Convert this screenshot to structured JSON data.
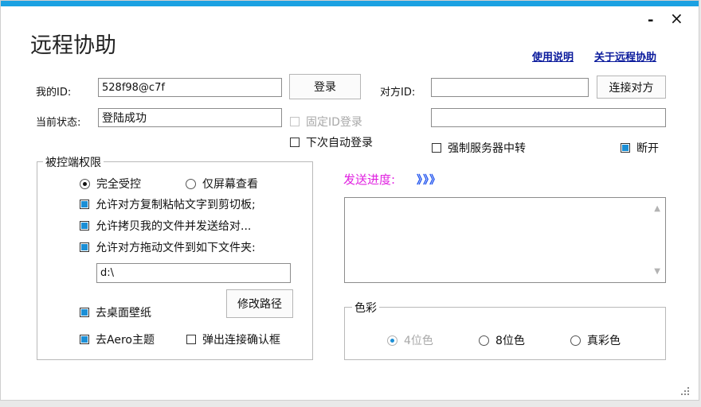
{
  "window": {
    "title": "远程协助",
    "minimize_label": "-",
    "close_label": "×"
  },
  "links": {
    "help": "使用说明",
    "about": "关于远程协助"
  },
  "my_id": {
    "label": "我的ID:",
    "value": "528f98@c7f"
  },
  "login_button": "登录",
  "peer_id": {
    "label": "对方ID:",
    "value": ""
  },
  "connect_button": "连接对方",
  "status": {
    "label": "当前状态:",
    "value": "登陆成功"
  },
  "peer_status_value": "",
  "fixed_id_login": {
    "label": "固定ID登录",
    "checked": false,
    "disabled": true
  },
  "auto_login": {
    "label": "下次自动登录",
    "checked": false
  },
  "force_relay": {
    "label": "强制服务器中转",
    "checked": false
  },
  "disconnect": {
    "label": "断开",
    "checked": true
  },
  "permissions": {
    "title": "被控端权限",
    "full_control": {
      "label": "完全受控",
      "selected": true
    },
    "view_only": {
      "label": "仅屏幕查看",
      "selected": false
    },
    "allow_clipboard": {
      "label": "允许对方复制粘帖文字到剪切板;",
      "checked": true
    },
    "allow_copy_files": {
      "label": "允许拷贝我的文件并发送给对...",
      "checked": true
    },
    "allow_drag_files": {
      "label": "允许对方拖动文件到如下文件夹:",
      "checked": true
    },
    "folder_path": "d:\\",
    "modify_path_button": "修改路径",
    "remove_wallpaper": {
      "label": "去桌面壁纸",
      "checked": true
    },
    "remove_aero": {
      "label": "去Aero主题",
      "checked": true
    },
    "popup_confirm": {
      "label": "弹出连接确认框",
      "checked": false
    }
  },
  "send_progress": {
    "label": "发送进度:",
    "indicator": "》》》"
  },
  "color": {
    "title": "色彩",
    "options": [
      {
        "label": "4位色",
        "selected": true,
        "disabled": true
      },
      {
        "label": "8位色",
        "selected": false,
        "disabled": false
      },
      {
        "label": "真彩色",
        "selected": false,
        "disabled": false
      }
    ]
  },
  "icons": {
    "scroll_up": "triangle-up",
    "scroll_down": "triangle-down",
    "resize_grip": "resize-grip-icon"
  },
  "colors": {
    "accent_bar": "#1ba1e2",
    "checkbox_fill": "#1b8fd6",
    "progress_label": "#e020e0",
    "progress_indicator": "#2255ee",
    "link": "#0a1a9c"
  }
}
